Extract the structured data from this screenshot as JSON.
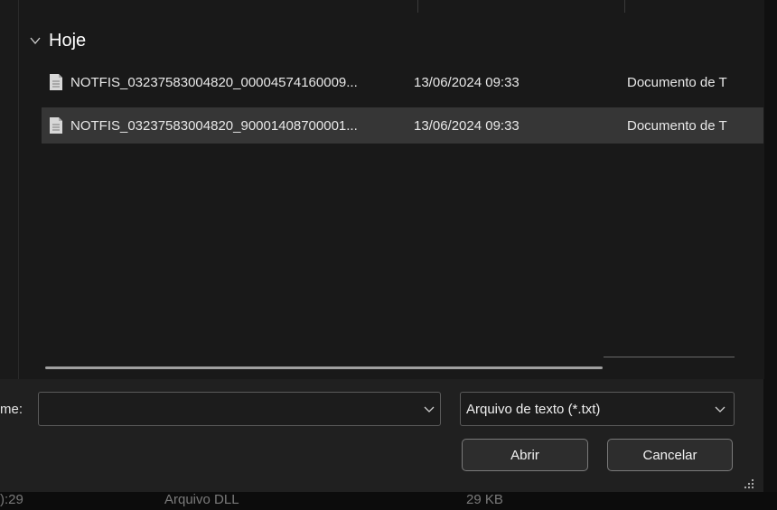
{
  "group": {
    "label": "Hoje"
  },
  "files": [
    {
      "name": "NOTFIS_03237583004820_00004574160009...",
      "date": "13/06/2024 09:33",
      "type": "Documento de T",
      "selected": false
    },
    {
      "name": "NOTFIS_03237583004820_90001408700001...",
      "date": "13/06/2024 09:33",
      "type": "Documento de T",
      "selected": true
    }
  ],
  "footer": {
    "name_label": "me:",
    "name_value": "",
    "file_type": "Arquivo de texto (*.txt)",
    "open_label": "Abrir",
    "cancel_label": "Cancelar"
  },
  "background_row": {
    "time_fragment": "):29",
    "type": "Arquivo DLL",
    "size": "29 KB"
  },
  "colors": {
    "dialog_bg": "#1a1a1a",
    "selected_row": "#363636",
    "panel_bg": "#202020",
    "border": "#5a5a5a"
  }
}
